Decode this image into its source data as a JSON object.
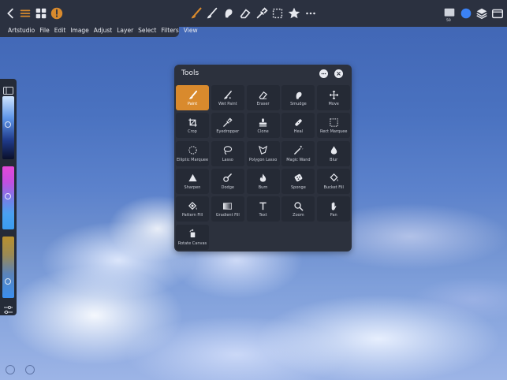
{
  "menubar": {
    "items": [
      "Artstudio",
      "File",
      "Edit",
      "Image",
      "Adjust",
      "Layer",
      "Select",
      "Filters",
      "View"
    ]
  },
  "toolbar": {
    "layer_badge": "50",
    "accent_color": "#d98a2d",
    "color_swatch": "#3b82f6"
  },
  "panel": {
    "title": "Tools",
    "tools": [
      {
        "label": "Paint",
        "icon": "brush-icon",
        "active": true
      },
      {
        "label": "Wet Paint",
        "icon": "wet-brush-icon"
      },
      {
        "label": "Eraser",
        "icon": "eraser-icon"
      },
      {
        "label": "Smudge",
        "icon": "smudge-icon"
      },
      {
        "label": "Move",
        "icon": "move-icon"
      },
      {
        "label": "Crop",
        "icon": "crop-icon"
      },
      {
        "label": "Eyedropper",
        "icon": "eyedropper-icon"
      },
      {
        "label": "Clone",
        "icon": "clone-stamp-icon"
      },
      {
        "label": "Heal",
        "icon": "bandage-icon"
      },
      {
        "label": "Rect Marquee",
        "icon": "rect-marquee-icon"
      },
      {
        "label": "Elliptic Marquee",
        "icon": "ellipse-marquee-icon"
      },
      {
        "label": "Lasso",
        "icon": "lasso-icon"
      },
      {
        "label": "Polygon Lasso",
        "icon": "polygon-lasso-icon"
      },
      {
        "label": "Magic Wand",
        "icon": "magic-wand-icon"
      },
      {
        "label": "Blur",
        "icon": "drop-icon"
      },
      {
        "label": "Sharpen",
        "icon": "triangle-icon"
      },
      {
        "label": "Dodge",
        "icon": "dodge-icon"
      },
      {
        "label": "Burn",
        "icon": "flame-icon"
      },
      {
        "label": "Sponge",
        "icon": "sponge-icon"
      },
      {
        "label": "Bucket Fill",
        "icon": "bucket-icon"
      },
      {
        "label": "Pattern Fill",
        "icon": "pattern-fill-icon"
      },
      {
        "label": "Gradient Fill",
        "icon": "gradient-icon"
      },
      {
        "label": "Text",
        "icon": "text-icon"
      },
      {
        "label": "Zoom",
        "icon": "zoom-icon"
      },
      {
        "label": "Pan",
        "icon": "hand-icon"
      },
      {
        "label": "Rotate Canvas",
        "icon": "rotate-canvas-icon"
      }
    ]
  }
}
